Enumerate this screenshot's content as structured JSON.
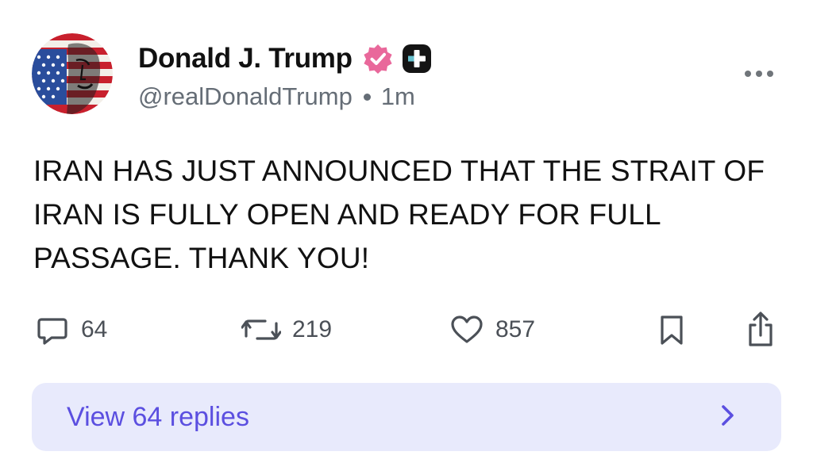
{
  "author": {
    "display_name": "Donald J. Trump",
    "handle": "@realDonaldTrump",
    "timestamp": "1m",
    "avatar_icon": "flag-portrait-avatar",
    "verified_icon": "verified-badge-icon",
    "verified_color": "#e9689b",
    "plus_icon": "plus-badge-icon"
  },
  "post": {
    "text": "IRAN HAS JUST ANNOUNCED THAT THE STRAIT OF IRAN IS FULLY OPEN AND READY FOR FULL PASSAGE. THANK YOU!"
  },
  "actions": {
    "replies": {
      "icon": "comment-icon",
      "count": "64"
    },
    "reposts": {
      "icon": "repost-icon",
      "count": "219"
    },
    "likes": {
      "icon": "heart-icon",
      "count": "857"
    },
    "bookmark": {
      "icon": "bookmark-icon"
    },
    "share": {
      "icon": "share-icon"
    }
  },
  "footer": {
    "view_replies_label": "View 64 replies",
    "chevron_icon": "chevron-right-icon",
    "accent_color": "#5b4fe0",
    "background_color": "#e8eafc"
  },
  "more_icon": "more-dots-icon"
}
